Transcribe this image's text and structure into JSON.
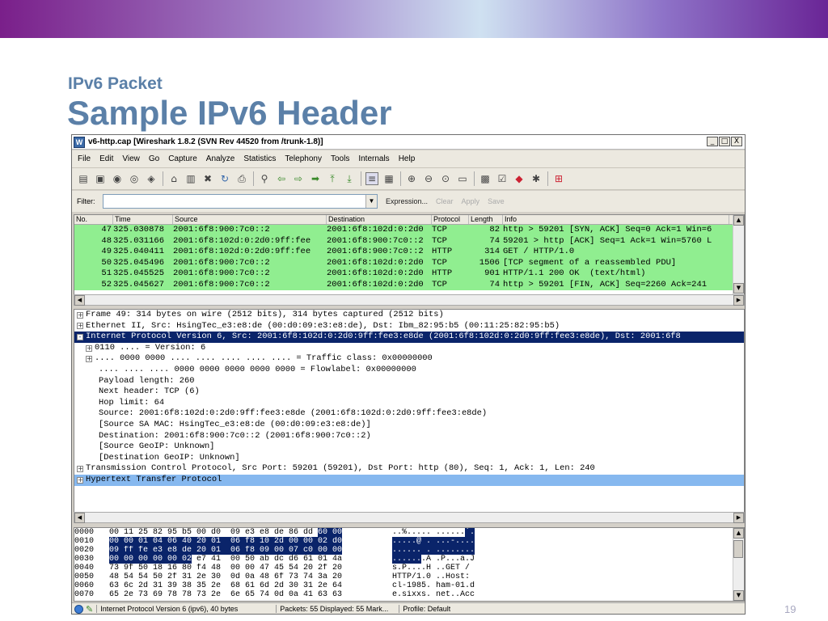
{
  "slide": {
    "subtitle": "IPv6 Packet",
    "title": "Sample IPv6 Header",
    "page": "19"
  },
  "window": {
    "title": "v6-http.cap  [Wireshark 1.8.2  (SVN Rev 44520 from /trunk-1.8)]",
    "buttons": [
      "_",
      "□",
      "X"
    ]
  },
  "menu": [
    "File",
    "Edit",
    "View",
    "Go",
    "Capture",
    "Analyze",
    "Statistics",
    "Telephony",
    "Tools",
    "Internals",
    "Help"
  ],
  "filter": {
    "label": "Filter:",
    "value": "",
    "expression": "Expression...",
    "clear": "Clear",
    "apply": "Apply",
    "save": "Save"
  },
  "packet_list": {
    "columns": [
      "No.",
      "Time",
      "Source",
      "Destination",
      "Protocol",
      "Length",
      "Info"
    ],
    "row_color": "#90ee90",
    "rows": [
      {
        "no": "47",
        "time": "325.030878",
        "src": "2001:6f8:900:7c0::2",
        "dst": "2001:6f8:102d:0:2d0",
        "proto": "TCP",
        "len": "82",
        "info": "http > 59201 [SYN, ACK] Seq=0 Ack=1 Win=6"
      },
      {
        "no": "48",
        "time": "325.031166",
        "src": "2001:6f8:102d:0:2d0:9ff:fee",
        "dst": "2001:6f8:900:7c0::2",
        "proto": "TCP",
        "len": "74",
        "info": "59201 > http [ACK] Seq=1 Ack=1 Win=5760 L"
      },
      {
        "no": "49",
        "time": "325.040411",
        "src": "2001:6f8:102d:0:2d0:9ff:fee",
        "dst": "2001:6f8:900:7c0::2",
        "proto": "HTTP",
        "len": "314",
        "info": "GET / HTTP/1.0"
      },
      {
        "no": "50",
        "time": "325.045496",
        "src": "2001:6f8:900:7c0::2",
        "dst": "2001:6f8:102d:0:2d0",
        "proto": "TCP",
        "len": "1506",
        "info": "[TCP segment of a reassembled PDU]"
      },
      {
        "no": "51",
        "time": "325.045525",
        "src": "2001:6f8:900:7c0::2",
        "dst": "2001:6f8:102d:0:2d0",
        "proto": "HTTP",
        "len": "901",
        "info": "HTTP/1.1 200 OK  (text/html)"
      },
      {
        "no": "52",
        "time": "325.045627",
        "src": "2001:6f8:900:7c0::2",
        "dst": "2001:6f8:102d:0:2d0",
        "proto": "TCP",
        "len": "74",
        "info": "http > 59201 [FIN, ACK] Seq=2260 Ack=241"
      }
    ]
  },
  "details": [
    {
      "exp": "+",
      "text": "Frame 49: 314 bytes on wire (2512 bits), 314 bytes captured (2512 bits)",
      "style": "",
      "indent": 0
    },
    {
      "exp": "+",
      "text": "Ethernet II, Src: HsingTec_e3:e8:de (00:d0:09:e3:e8:de), Dst: Ibm_82:95:b5 (00:11:25:82:95:b5)",
      "style": "",
      "indent": 0
    },
    {
      "exp": "-",
      "text": "Internet Protocol Version 6, Src: 2001:6f8:102d:0:2d0:9ff:fee3:e8de (2001:6f8:102d:0:2d0:9ff:fee3:e8de), Dst: 2001:6f8",
      "style": "sel",
      "indent": 0
    },
    {
      "exp": "+",
      "text": "0110 .... = Version: 6",
      "style": "",
      "indent": 1
    },
    {
      "exp": "+",
      "text": ".... 0000 0000 .... .... .... .... .... = Traffic class: 0x00000000",
      "style": "",
      "indent": 1
    },
    {
      "exp": "",
      "text": ".... .... .... 0000 0000 0000 0000 0000 = Flowlabel: 0x00000000",
      "style": "",
      "indent": 2
    },
    {
      "exp": "",
      "text": "Payload length: 260",
      "style": "",
      "indent": 2
    },
    {
      "exp": "",
      "text": "Next header: TCP (6)",
      "style": "",
      "indent": 2
    },
    {
      "exp": "",
      "text": "Hop limit: 64",
      "style": "",
      "indent": 2
    },
    {
      "exp": "",
      "text": "Source: 2001:6f8:102d:0:2d0:9ff:fee3:e8de (2001:6f8:102d:0:2d0:9ff:fee3:e8de)",
      "style": "",
      "indent": 2
    },
    {
      "exp": "",
      "text": "[Source SA MAC: HsingTec_e3:e8:de (00:d0:09:e3:e8:de)]",
      "style": "",
      "indent": 2
    },
    {
      "exp": "",
      "text": "Destination: 2001:6f8:900:7c0::2 (2001:6f8:900:7c0::2)",
      "style": "",
      "indent": 2
    },
    {
      "exp": "",
      "text": "[Source GeoIP: Unknown]",
      "style": "",
      "indent": 2
    },
    {
      "exp": "",
      "text": "[Destination GeoIP: Unknown]",
      "style": "",
      "indent": 2
    },
    {
      "exp": "+",
      "text": "Transmission Control Protocol, Src Port: 59201 (59201), Dst Port: http (80), Seq: 1, Ack: 1, Len: 240",
      "style": "",
      "indent": 0
    },
    {
      "exp": "+",
      "text": "Hypertext Transfer Protocol",
      "style": "hl",
      "indent": 0
    }
  ],
  "hex": [
    {
      "off": "0000",
      "pre": "00 11 25 82 95 b5 00 d0  09 e3 e8 de 86 dd ",
      "sel": "60 00",
      "post": "",
      "apre": "..%..... ......",
      "asel": "`.",
      "apost": ""
    },
    {
      "off": "0010",
      "pre": "",
      "sel": "00 00 01 04 06 40 20 01  06 f8 10 2d 00 00 02 d0",
      "post": "",
      "apre": "",
      "asel": ".....@ . ...-....",
      "apost": ""
    },
    {
      "off": "0020",
      "pre": "",
      "sel": "09 ff fe e3 e8 de 20 01  06 f8 09 00 07 c0 00 00",
      "post": "",
      "apre": "",
      "asel": "...... . ........",
      "apost": ""
    },
    {
      "off": "0030",
      "pre": "",
      "sel": "00 00 00 00 00 02",
      "post": " e7 41  00 50 ab dc d6 61 01 4a",
      "apre": "",
      "asel": "......",
      "apost": ".A .P...a.J"
    },
    {
      "off": "0040",
      "pre": "73 9f 50 18 16 80 f4 48  00 00 47 45 54 20 2f 20",
      "sel": "",
      "post": "",
      "apre": "s.P....H ..GET /",
      "asel": "",
      "apost": ""
    },
    {
      "off": "0050",
      "pre": "48 54 54 50 2f 31 2e 30  0d 0a 48 6f 73 74 3a 20",
      "sel": "",
      "post": "",
      "apre": "HTTP/1.0 ..Host:",
      "asel": "",
      "apost": ""
    },
    {
      "off": "0060",
      "pre": "63 6c 2d 31 39 38 35 2e  68 61 6d 2d 30 31 2e 64",
      "sel": "",
      "post": "",
      "apre": "cl-1985. ham-01.d",
      "asel": "",
      "apost": ""
    },
    {
      "off": "0070",
      "pre": "65 2e 73 69 78 78 73 2e  6e 65 74 0d 0a 41 63 63",
      "sel": "",
      "post": "",
      "apre": "e.sixxs. net..Acc",
      "asel": "",
      "apost": ""
    }
  ],
  "status": {
    "field": "Internet Protocol Version 6 (ipv6), 40 bytes",
    "packets": "Packets: 55 Displayed: 55 Mark...",
    "profile": "Profile: Default"
  }
}
